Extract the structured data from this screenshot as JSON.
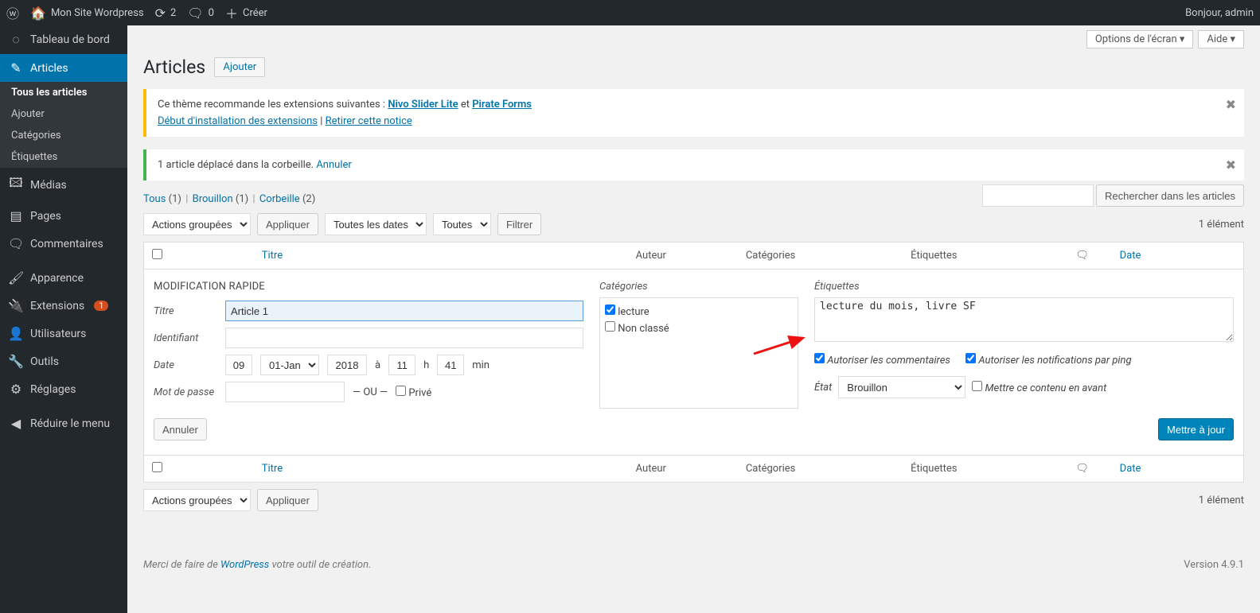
{
  "adminbar": {
    "site_name": "Mon Site Wordpress",
    "updates_count": "2",
    "comments_count": "0",
    "new_label": "Créer",
    "howdy": "Bonjour, admin"
  },
  "sidebar": {
    "dashboard": "Tableau de bord",
    "posts": "Articles",
    "posts_sub": {
      "all": "Tous les articles",
      "add": "Ajouter",
      "categories": "Catégories",
      "tags": "Étiquettes"
    },
    "media": "Médias",
    "pages": "Pages",
    "comments": "Commentaires",
    "appearance": "Apparence",
    "plugins": "Extensions",
    "plugins_badge": "1",
    "users": "Utilisateurs",
    "tools": "Outils",
    "settings": "Réglages",
    "collapse": "Réduire le menu"
  },
  "header": {
    "screen_options": "Options de l'écran",
    "help": "Aide",
    "title": "Articles",
    "add_new": "Ajouter"
  },
  "notice_plugins": {
    "text_prefix": "Ce thème recommande les extensions suivantes : ",
    "link1": "Nivo Slider Lite",
    "and": " et ",
    "link2": "Pirate Forms",
    "install": "Début d'installation des extensions",
    "sep": " | ",
    "dismiss": "Retirer cette notice"
  },
  "notice_trash": {
    "text": "1 article déplacé dans la corbeille. ",
    "undo": "Annuler"
  },
  "views": {
    "all": "Tous",
    "all_count": "(1)",
    "draft": "Brouillon",
    "draft_count": "(1)",
    "trash": "Corbeille",
    "trash_count": "(2)"
  },
  "filters": {
    "bulk": "Actions groupées",
    "apply": "Appliquer",
    "dates": "Toutes les dates",
    "cats": "Toutes",
    "filter": "Filtrer",
    "search": "Rechercher dans les articles",
    "count": "1 élément"
  },
  "columns": {
    "title": "Titre",
    "author": "Auteur",
    "categories": "Catégories",
    "tags": "Étiquettes",
    "date": "Date"
  },
  "quickedit": {
    "heading": "MODIFICATION RAPIDE",
    "title_label": "Titre",
    "title_value": "Article 1",
    "slug_label": "Identifiant",
    "slug_value": "",
    "date_label": "Date",
    "day": "09",
    "month": "01-Jan",
    "year": "2018",
    "at": "à",
    "hour": "11",
    "h": "h",
    "min": "41",
    "min_label": "min",
    "password_label": "Mot de passe",
    "password_value": "",
    "or": "— OU —",
    "private_label": "Privé",
    "categories_heading": "Catégories",
    "cat_lecture": "lecture",
    "cat_nonclasse": "Non classé",
    "tags_heading": "Étiquettes",
    "tags_value": "lecture du mois, livre SF",
    "allow_comments": "Autoriser les commentaires",
    "allow_pings": "Autoriser les notifications par ping",
    "status_label": "État",
    "status_value": "Brouillon",
    "sticky": "Mettre ce contenu en avant",
    "cancel": "Annuler",
    "update": "Mettre à jour"
  },
  "footer": {
    "thankyou_pre": "Merci de faire de ",
    "wp": "WordPress",
    "thankyou_post": " votre outil de création.",
    "version": "Version 4.9.1"
  }
}
